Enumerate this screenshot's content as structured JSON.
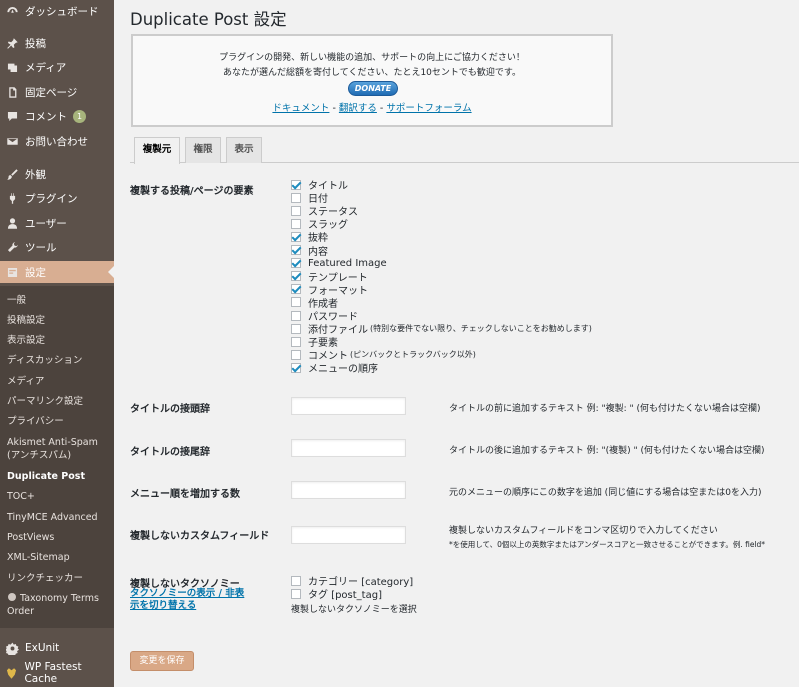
{
  "sidebar": {
    "items": [
      {
        "label": "ダッシュボード",
        "icon": "dashboard-icon"
      },
      {
        "label": "投稿",
        "icon": "pushpin-icon"
      },
      {
        "label": "メディア",
        "icon": "media-icon"
      },
      {
        "label": "固定ページ",
        "icon": "page-icon"
      },
      {
        "label": "コメント",
        "icon": "comment-icon",
        "badge": "1"
      },
      {
        "label": "お問い合わせ",
        "icon": "mail-icon"
      },
      {
        "label": "外観",
        "icon": "brush-icon"
      },
      {
        "label": "プラグイン",
        "icon": "plugin-icon"
      },
      {
        "label": "ユーザー",
        "icon": "user-icon"
      },
      {
        "label": "ツール",
        "icon": "wrench-icon"
      },
      {
        "label": "設定",
        "icon": "settings-icon"
      },
      {
        "label": "ExUnit",
        "icon": "gear-icon"
      },
      {
        "label": "WP Fastest Cache",
        "icon": "cheetah-icon"
      }
    ],
    "submenu": [
      "一般",
      "投稿設定",
      "表示設定",
      "ディスカッション",
      "メディア",
      "パーマリンク設定",
      "プライバシー",
      "Akismet Anti-Spam (アンチスパム)",
      "Duplicate Post",
      "TOC+",
      "TinyMCE Advanced",
      "PostViews",
      "XML-Sitemap",
      "リンクチェッカー",
      "Taxonomy Terms Order"
    ]
  },
  "page": {
    "title": "Duplicate Post 設定"
  },
  "donate": {
    "line1": "プラグインの開発、新しい機能の追加、サポートの向上にご協力ください！",
    "line2": "あなたが選んだ総額を寄付してください、たとえ10セントでも歓迎です。",
    "button": "DONATE",
    "link_docs": "ドキュメント",
    "link_translate": "翻訳する",
    "link_support": "サポートフォーラム",
    "sep": " - "
  },
  "tabs": [
    "複製元",
    "権限",
    "表示"
  ],
  "form": {
    "elements_label": "複製する投稿/ページの要素",
    "elements": [
      {
        "label": "タイトル",
        "checked": true
      },
      {
        "label": "日付",
        "checked": false
      },
      {
        "label": "ステータス",
        "checked": false
      },
      {
        "label": "スラッグ",
        "checked": false
      },
      {
        "label": "抜粋",
        "checked": true
      },
      {
        "label": "内容",
        "checked": true
      },
      {
        "label": "Featured Image",
        "checked": true
      },
      {
        "label": "テンプレート",
        "checked": true
      },
      {
        "label": "フォーマット",
        "checked": true
      },
      {
        "label": "作成者",
        "checked": false
      },
      {
        "label": "パスワード",
        "checked": false
      },
      {
        "label": "添付ファイル",
        "checked": false,
        "note": "(特別な要件でない限り、チェックしないことをお勧めします)"
      },
      {
        "label": "子要素",
        "checked": false
      },
      {
        "label": "コメント",
        "checked": false,
        "note": "(ピンバックとトラックバック以外)"
      },
      {
        "label": "メニューの順序",
        "checked": true
      }
    ],
    "prefix_label": "タイトルの接頭辞",
    "prefix_desc": "タイトルの前に追加するテキスト 例: \"複製: \" (何も付けたくない場合は空欄)",
    "suffix_label": "タイトルの接尾辞",
    "suffix_desc": "タイトルの後に追加するテキスト 例: \"(複製) \" (何も付けたくない場合は空欄)",
    "menu_order_label": "メニュー順を増加する数",
    "menu_order_desc": "元のメニューの順序にこの数字を追加 (同じ値にする場合は空または0を入力)",
    "custom_fields_label": "複製しないカスタムフィールド",
    "custom_fields_desc": "複製しないカスタムフィールドをコンマ区切りで入力してください",
    "custom_fields_note": "*を使用して、0個以上の英数字またはアンダースコアと一致させることができます。例. field*",
    "taxonomy_label": "複製しないタクソノミー",
    "taxonomy_toggle": "タクソノミーの表示 / 非表示を切り替える",
    "taxonomies": [
      {
        "label": "カテゴリー [category]",
        "checked": false
      },
      {
        "label": "タグ [post_tag]",
        "checked": false
      }
    ],
    "taxonomy_note": "複製しないタクソノミーを選択",
    "save_label": "変更を保存"
  },
  "colors": {
    "sidebar_bg": "#5c514a",
    "submenu_bg": "#4c433d",
    "current_menu": "#d8ae92",
    "save_button": "#d9a886",
    "link": "#0073aa"
  }
}
